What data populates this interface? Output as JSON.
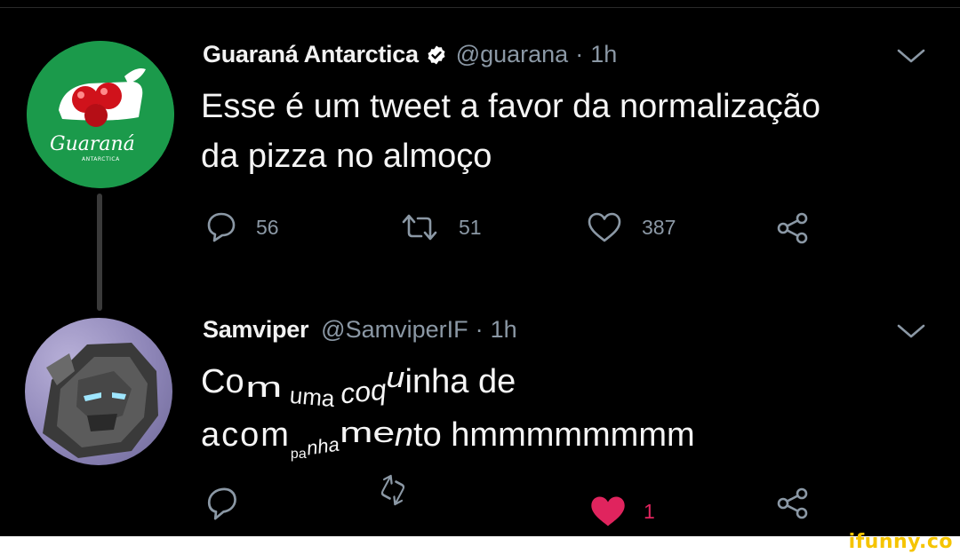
{
  "tweet1": {
    "display_name": "Guaraná Antarctica",
    "handle": "@guarana",
    "separator": "·",
    "time": "1h",
    "text_line1": "Esse é um tweet a favor da normalização",
    "text_line2": "da pizza no almoço",
    "replies": "56",
    "retweets": "51",
    "likes": "387",
    "avatar_logo_text": "Guaraná",
    "avatar_logo_sub": "ANTARCTICA"
  },
  "tweet2": {
    "display_name": "Samviper",
    "handle": "@SamviperIF",
    "separator": "·",
    "time": "1h",
    "line1_a": "Co",
    "line1_b": "m",
    "line1_c": "uma",
    "line1_d": "coq",
    "line1_e": "u",
    "line1_f": "inha de",
    "line2_a": "acom",
    "line2_b": "pa",
    "line2_c": "nha",
    "line2_d": "me",
    "line2_e": "n",
    "line2_f": "to hmmmmmmmm",
    "likes": "1"
  },
  "colors": {
    "accent_like": "#e0245e",
    "muted": "#8b98a5",
    "brand_green": "#1b9a4b",
    "verified": "#ffffff"
  },
  "watermark": "ifunny.co"
}
